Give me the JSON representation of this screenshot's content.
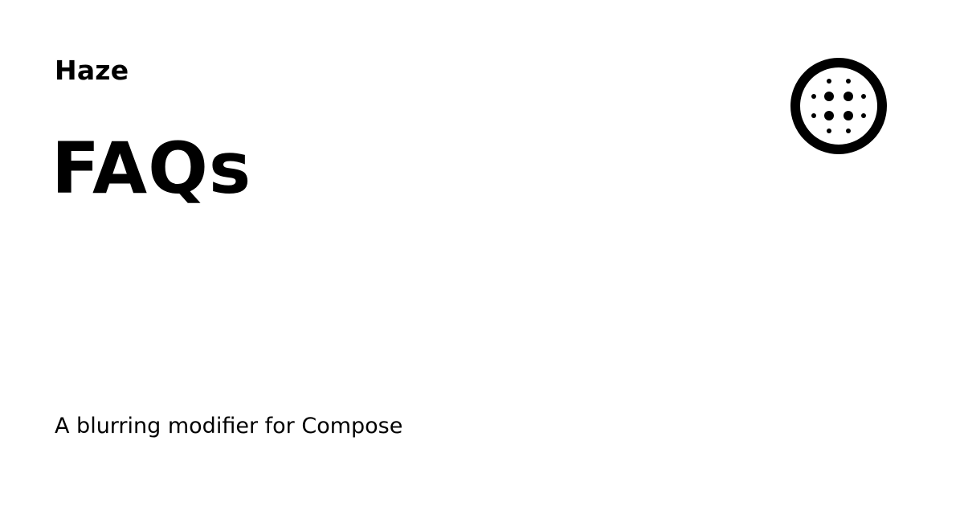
{
  "header": {
    "site_name": "Haze"
  },
  "main": {
    "page_title": "FAQs",
    "description": "A blurring modifier for Compose"
  },
  "logo": {
    "icon": "haze-logo-icon",
    "color": "#000000"
  },
  "colors": {
    "background": "#ffffff",
    "text": "#000000"
  }
}
